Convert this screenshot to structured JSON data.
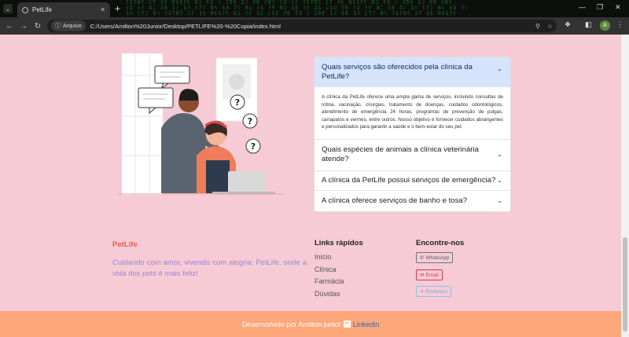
{
  "browser": {
    "tab_title": "PetLife",
    "address_chip": "Arquivo",
    "url": "C:/Users/Amilton%20Junior/Desktop/PETLIFE%20-%20Copia/index.html",
    "avatar_letter": "A",
    "icons": {
      "tab_menu": "chevron-down-icon",
      "new_tab": "plus-icon",
      "back": "arrow-left-icon",
      "forward": "arrow-right-icon",
      "reload": "reload-icon",
      "zoom": "zoom-icon",
      "bookmark": "star-icon",
      "extensions": "puzzle-icon",
      "sidebar": "sidebar-icon",
      "menu": "kebab-menu-icon"
    }
  },
  "faq": {
    "items": [
      {
        "question": "Quais serviços são oferecidos pela clínica da PetLife?",
        "answer": "A clínica da PetLife oferece uma ampla gama de serviços, incluindo consultas de rotina, vacinação, cirurgias, tratamento de doenças, cuidados odontológicos, atendimento de emergência 24 horas, programas de prevenção de pulgas, carrapatos e vermes, entre outros. Nosso objetivo é fornecer cuidados abrangentes e personalizados para garantir a saúde e o bem-estar do seu pet.",
        "expanded": true
      },
      {
        "question": "Quais espécies de animais a clínica veterinária atende?",
        "expanded": false
      },
      {
        "question": "A clínica da PetLife possui serviços de emergência?",
        "expanded": false
      },
      {
        "question": "A clínica oferece serviços de banho e tosa?",
        "expanded": false
      }
    ]
  },
  "footer": {
    "brand": "PetLife",
    "tagline": "Cuidando com amor, vivendo com alegria: PetLife, onde a vida dos pets é mais feliz!",
    "links_title": "Links rápidos",
    "links": [
      "Início",
      "Clínica",
      "Farmácia",
      "Dúvidas"
    ],
    "find_title": "Encontre-nos",
    "buttons": {
      "whatsapp": "WhatsApp",
      "email": "Email",
      "address": "Endereço"
    },
    "credit_text": "Desenvolvido por Amilton junior",
    "credit_link": "Linkedin"
  },
  "colors": {
    "page_bg": "#f6cbd5",
    "brand": "#e0604a",
    "tagline": "#9b86d4",
    "footer_bar": "#fda77a",
    "faq_open_bg": "#d6e4fb"
  }
}
